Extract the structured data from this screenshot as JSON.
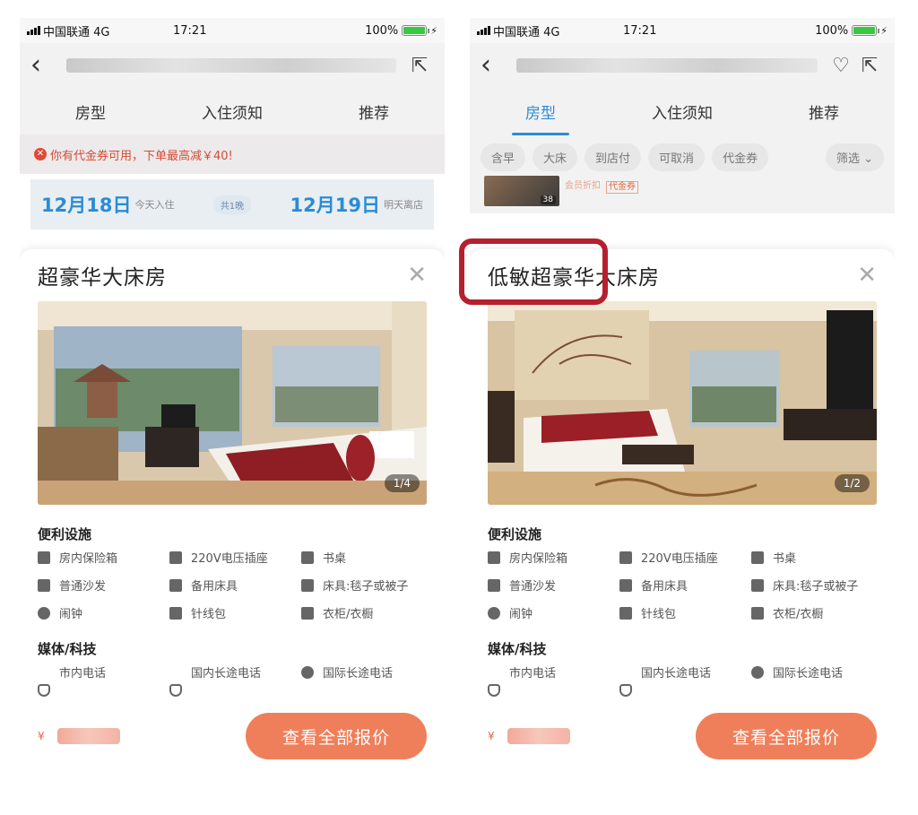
{
  "status": {
    "carrier": "中国联通",
    "network": "4G",
    "time": "17:21",
    "battery": "100%"
  },
  "tabs": [
    "房型",
    "入住须知",
    "推荐"
  ],
  "left": {
    "coupon_text": "你有代金券可用，下单最高减￥40!",
    "checkin_date": "12月18日",
    "checkin_sub": "今天入住",
    "nights": "共1晚",
    "checkout_date": "12月19日",
    "checkout_sub": "明天离店",
    "room_name": "超豪华大床房",
    "photo_counter": "1/4"
  },
  "right": {
    "filters": [
      "含早",
      "大床",
      "到店付",
      "可取消",
      "代金券",
      "筛选 ⌄"
    ],
    "thumb_count": "38",
    "tags": [
      "会员折扣",
      "代金券"
    ],
    "room_name": "低敏超豪华大床房",
    "photo_counter": "1/2"
  },
  "amenities": {
    "title": "便利设施",
    "items": [
      "房内保险箱",
      "220V电压插座",
      "书桌",
      "普通沙发",
      "备用床具",
      "床具:毯子或被子",
      "闹钟",
      "针线包",
      "衣柜/衣橱"
    ]
  },
  "media": {
    "title": "媒体/科技",
    "items": [
      "市内电话",
      "国内长途电话",
      "国际长途电话"
    ]
  },
  "footer": {
    "currency": "¥",
    "cta": "查看全部报价"
  },
  "colors": {
    "accent": "#2a8cd6",
    "cta": "#ef7f5a",
    "highlight": "#b5202f"
  }
}
